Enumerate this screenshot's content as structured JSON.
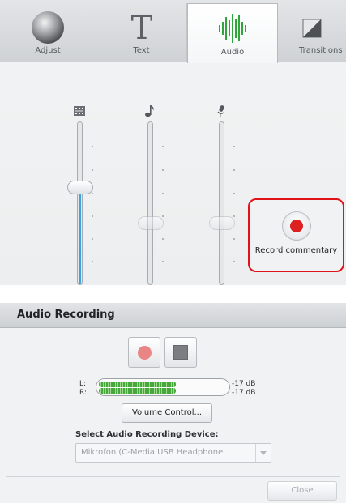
{
  "tabs": [
    {
      "label": "Adjust",
      "icon": "adjust-sphere-icon"
    },
    {
      "label": "Text",
      "icon": "text-t-icon"
    },
    {
      "label": "Audio",
      "icon": "audio-waveform-icon",
      "active": true
    },
    {
      "label": "Transitions",
      "icon": "transitions-icon"
    }
  ],
  "mixer": {
    "channels": [
      {
        "icon": "film-strip-icon",
        "level": 0.6
      },
      {
        "icon": "music-note-icon",
        "level": 0.38
      },
      {
        "icon": "microphone-icon",
        "level": 0.38
      }
    ],
    "active_color": "#3aa3e0"
  },
  "record_commentary": {
    "label": "Record commentary",
    "highlight_color": "#e0121a"
  },
  "audio_recording": {
    "title": "Audio Recording",
    "meter": {
      "left_label": "L:",
      "right_label": "R:",
      "left_db": "-17 dB",
      "right_db": "-17 dB",
      "left_level": 0.6,
      "right_level": 0.6
    },
    "volume_control_label": "Volume Control...",
    "device_label": "Select Audio Recording Device:",
    "device_value": "Mikrofon (C-Media USB Headphone",
    "close_label": "Close"
  }
}
